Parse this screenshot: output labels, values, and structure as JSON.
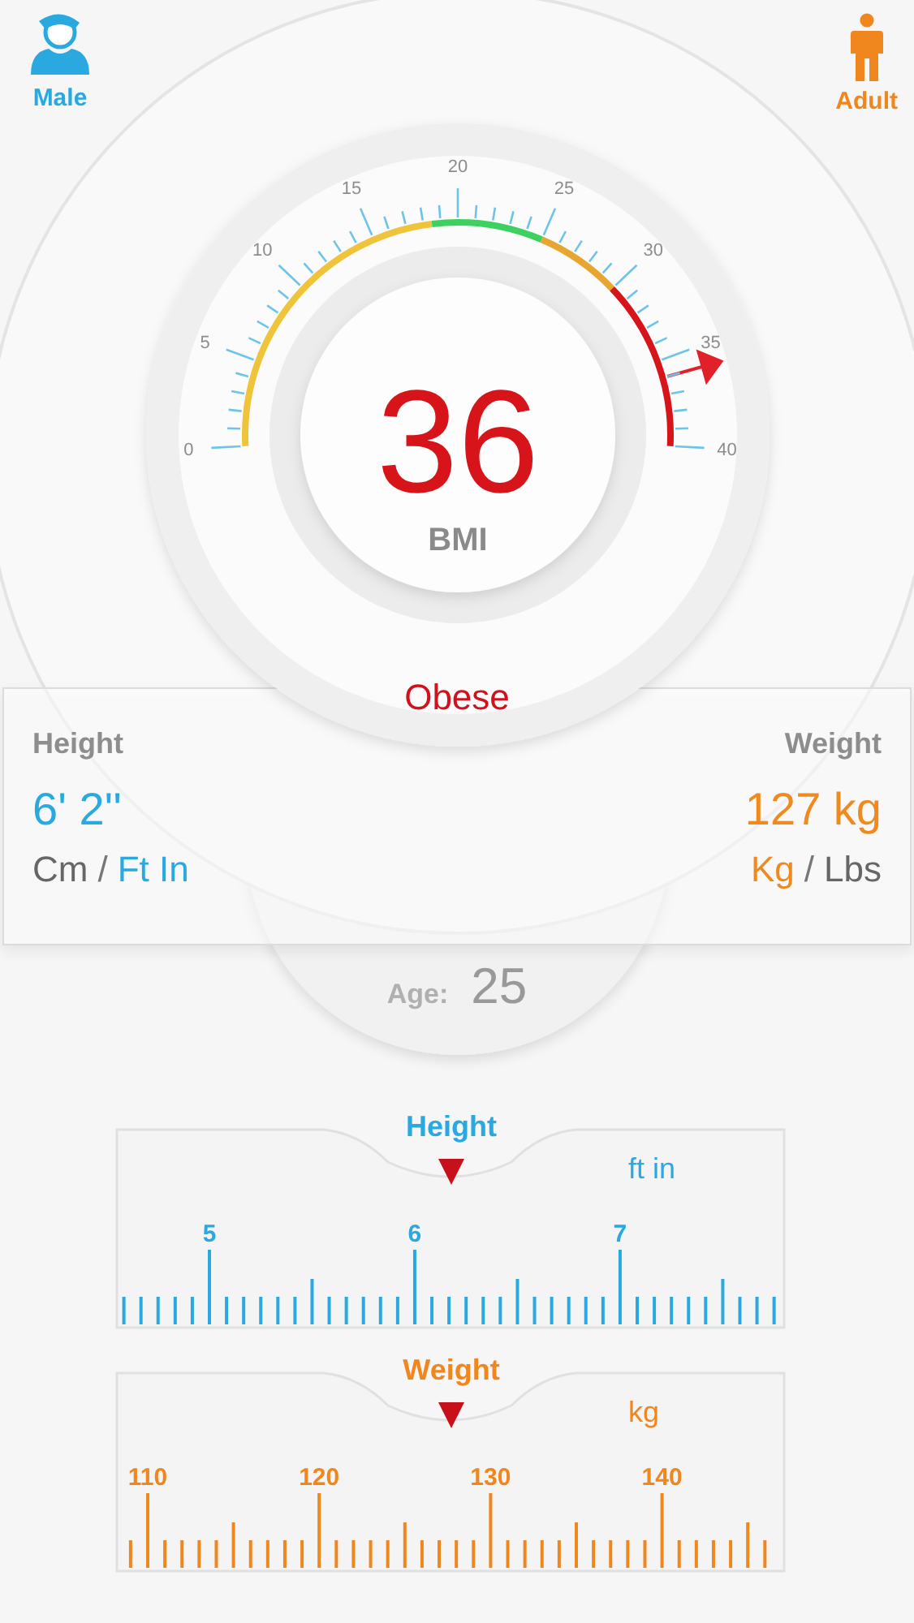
{
  "header": {
    "gender": {
      "label": "Male"
    },
    "age_group": {
      "label": "Adult"
    }
  },
  "gauge": {
    "scale_labels": [
      "0",
      "5",
      "10",
      "15",
      "20",
      "25",
      "30",
      "35",
      "40"
    ],
    "value": "36",
    "unit": "BMI",
    "category": "Obese"
  },
  "height": {
    "label": "Height",
    "value": "6' 2''",
    "separator": "/",
    "units": [
      {
        "label": "Cm",
        "selected": false
      },
      {
        "label": "Ft In",
        "selected": true
      }
    ]
  },
  "weight": {
    "label": "Weight",
    "value": "127 kg",
    "separator": "/",
    "units": [
      {
        "label": "Kg",
        "selected": true
      },
      {
        "label": "Lbs",
        "selected": false
      }
    ]
  },
  "age": {
    "label": "Age:",
    "value": "25"
  },
  "rulers": [
    {
      "kind": "height",
      "title": "Height",
      "unit": "ft in",
      "labels": [
        "5",
        "6",
        "7"
      ]
    },
    {
      "kind": "weight",
      "title": "Weight",
      "unit": "kg",
      "labels": [
        "110",
        "120",
        "130",
        "140"
      ]
    }
  ]
}
